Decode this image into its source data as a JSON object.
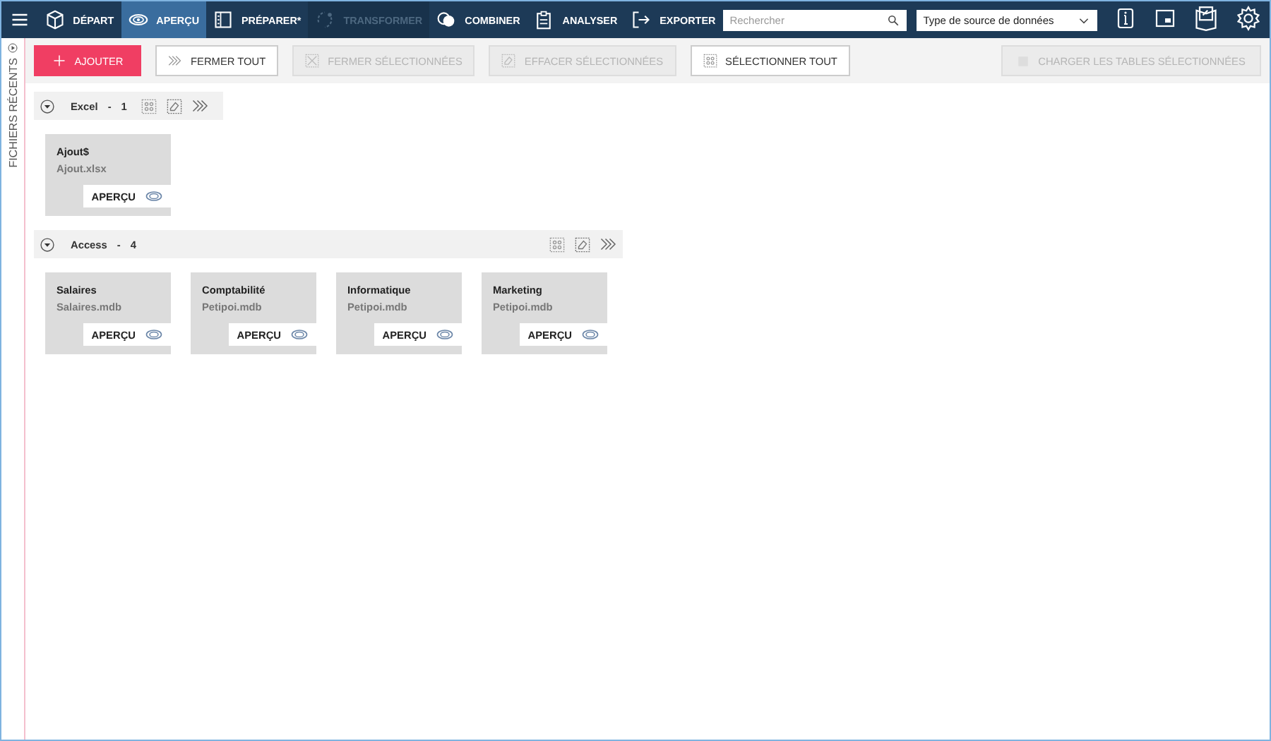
{
  "nav": {
    "tabs": [
      {
        "label": "DÉPART",
        "selected": false,
        "disabled": false
      },
      {
        "label": "APERÇU",
        "selected": true,
        "disabled": false
      },
      {
        "label": "PRÉPARER*",
        "selected": false,
        "disabled": false
      },
      {
        "label": "TRANSFORMER",
        "selected": false,
        "disabled": true
      },
      {
        "label": "COMBINER",
        "selected": false,
        "disabled": false
      },
      {
        "label": "ANALYSER",
        "selected": false,
        "disabled": false
      },
      {
        "label": "EXPORTER",
        "selected": false,
        "disabled": false
      }
    ],
    "search": {
      "placeholder": "Rechercher"
    },
    "source_type": {
      "value": "Type de source de données"
    }
  },
  "sidebar": {
    "label": "FICHIERS RÉCENTS"
  },
  "toolbar": {
    "buttons": [
      {
        "label": "AJOUTER",
        "kind": "primary",
        "disabled": false
      },
      {
        "label": "FERMER TOUT",
        "kind": "close",
        "disabled": false
      },
      {
        "label": "FERMER SÉLECTIONNÉES",
        "kind": "closesel",
        "disabled": true
      },
      {
        "label": "EFFACER SÉLECTIONNÉES",
        "kind": "erase",
        "disabled": true
      },
      {
        "label": "SÉLECTIONNER TOUT",
        "kind": "select",
        "disabled": false
      }
    ],
    "load_button": {
      "label": "CHARGER LES TABLES SÉLECTIONNÉES",
      "disabled": true
    }
  },
  "groups": [
    {
      "name": "Excel",
      "separator": "-",
      "count": "1",
      "tables": [
        {
          "name": "Ajout$",
          "file": "Ajout.xlsx",
          "preview": "APERÇU"
        }
      ]
    },
    {
      "name": "Access",
      "separator": "-",
      "count": "4",
      "tables": [
        {
          "name": "Salaires",
          "file": "Salaires.mdb",
          "preview": "APERÇU"
        },
        {
          "name": "Comptabilité",
          "file": "Petipoi.mdb",
          "preview": "APERÇU"
        },
        {
          "name": "Informatique",
          "file": "Petipoi.mdb",
          "preview": "APERÇU"
        },
        {
          "name": "Marketing",
          "file": "Petipoi.mdb",
          "preview": "APERÇU"
        }
      ]
    }
  ]
}
